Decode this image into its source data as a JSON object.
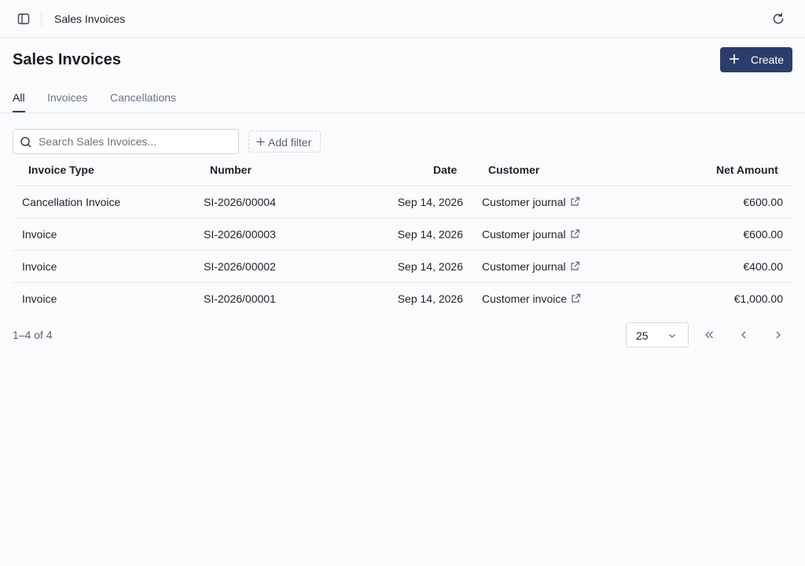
{
  "topbar": {
    "breadcrumb": "Sales Invoices",
    "icons": [
      "sidebar-toggle-icon",
      "refresh-icon"
    ]
  },
  "page": {
    "title": "Sales Invoices",
    "create_label": "Create"
  },
  "tabs": [
    {
      "label": "All",
      "active": true
    },
    {
      "label": "Invoices",
      "active": false
    },
    {
      "label": "Cancellations",
      "active": false
    }
  ],
  "filters": {
    "search_placeholder": "Search Sales Invoices...",
    "add_filter_label": "Add filter"
  },
  "table": {
    "columns": [
      "Invoice Type",
      "Number",
      "Date",
      "Customer",
      "Net Amount"
    ],
    "rows": [
      {
        "type": "Cancellation Invoice",
        "number": "SI-2026/00004",
        "date": "Sep 14, 2026",
        "customer": "Customer journal",
        "amount": "€600.00"
      },
      {
        "type": "Invoice",
        "number": "SI-2026/00003",
        "date": "Sep 14, 2026",
        "customer": "Customer journal",
        "amount": "€600.00"
      },
      {
        "type": "Invoice",
        "number": "SI-2026/00002",
        "date": "Sep 14, 2026",
        "customer": "Customer journal",
        "amount": "€400.00"
      },
      {
        "type": "Invoice",
        "number": "SI-2026/00001",
        "date": "Sep 14, 2026",
        "customer": "Customer invoice",
        "amount": "€1,000.00"
      }
    ]
  },
  "pagination": {
    "range": "1–4 of 4",
    "page_size": "25"
  },
  "colors": {
    "accent": "#2b3e6b",
    "background": "#fafbfd",
    "border": "#e6e8ec"
  }
}
